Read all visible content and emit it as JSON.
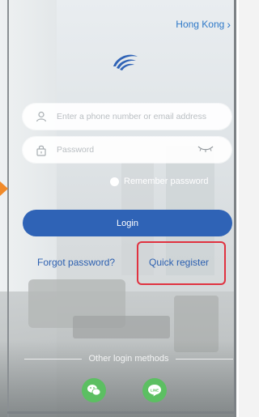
{
  "header": {
    "region_label": "Hong Kong"
  },
  "form": {
    "account_placeholder": "Enter a phone number or email address",
    "password_placeholder": "Password",
    "remember_label": "Remember password",
    "login_label": "Login"
  },
  "links": {
    "forgot_label": "Forgot password?",
    "quick_register_label": "Quick register"
  },
  "other_login": {
    "label": "Other login methods",
    "methods": [
      "wechat",
      "line"
    ]
  },
  "colors": {
    "accent": "#2f63b6",
    "link": "#2d60b0",
    "region": "#2f79c8",
    "social_green": "#5cbf62",
    "highlight": "#e03240"
  },
  "icons": [
    "chevron-right-icon",
    "app-logo-icon",
    "user-icon",
    "lock-icon",
    "eye-closed-icon",
    "wechat-icon",
    "line-icon"
  ]
}
